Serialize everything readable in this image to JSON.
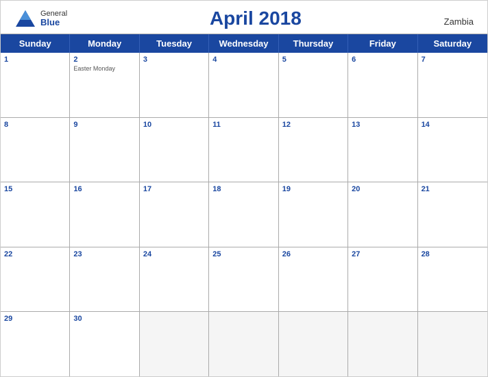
{
  "header": {
    "logo_general": "General",
    "logo_blue": "Blue",
    "title": "April 2018",
    "country": "Zambia"
  },
  "day_headers": [
    "Sunday",
    "Monday",
    "Tuesday",
    "Wednesday",
    "Thursday",
    "Friday",
    "Saturday"
  ],
  "weeks": [
    [
      {
        "day": "1",
        "holiday": "",
        "in_month": true
      },
      {
        "day": "2",
        "holiday": "Easter Monday",
        "in_month": true
      },
      {
        "day": "3",
        "holiday": "",
        "in_month": true
      },
      {
        "day": "4",
        "holiday": "",
        "in_month": true
      },
      {
        "day": "5",
        "holiday": "",
        "in_month": true
      },
      {
        "day": "6",
        "holiday": "",
        "in_month": true
      },
      {
        "day": "7",
        "holiday": "",
        "in_month": true
      }
    ],
    [
      {
        "day": "8",
        "holiday": "",
        "in_month": true
      },
      {
        "day": "9",
        "holiday": "",
        "in_month": true
      },
      {
        "day": "10",
        "holiday": "",
        "in_month": true
      },
      {
        "day": "11",
        "holiday": "",
        "in_month": true
      },
      {
        "day": "12",
        "holiday": "",
        "in_month": true
      },
      {
        "day": "13",
        "holiday": "",
        "in_month": true
      },
      {
        "day": "14",
        "holiday": "",
        "in_month": true
      }
    ],
    [
      {
        "day": "15",
        "holiday": "",
        "in_month": true
      },
      {
        "day": "16",
        "holiday": "",
        "in_month": true
      },
      {
        "day": "17",
        "holiday": "",
        "in_month": true
      },
      {
        "day": "18",
        "holiday": "",
        "in_month": true
      },
      {
        "day": "19",
        "holiday": "",
        "in_month": true
      },
      {
        "day": "20",
        "holiday": "",
        "in_month": true
      },
      {
        "day": "21",
        "holiday": "",
        "in_month": true
      }
    ],
    [
      {
        "day": "22",
        "holiday": "",
        "in_month": true
      },
      {
        "day": "23",
        "holiday": "",
        "in_month": true
      },
      {
        "day": "24",
        "holiday": "",
        "in_month": true
      },
      {
        "day": "25",
        "holiday": "",
        "in_month": true
      },
      {
        "day": "26",
        "holiday": "",
        "in_month": true
      },
      {
        "day": "27",
        "holiday": "",
        "in_month": true
      },
      {
        "day": "28",
        "holiday": "",
        "in_month": true
      }
    ],
    [
      {
        "day": "29",
        "holiday": "",
        "in_month": true
      },
      {
        "day": "30",
        "holiday": "",
        "in_month": true
      },
      {
        "day": "",
        "holiday": "",
        "in_month": false
      },
      {
        "day": "",
        "holiday": "",
        "in_month": false
      },
      {
        "day": "",
        "holiday": "",
        "in_month": false
      },
      {
        "day": "",
        "holiday": "",
        "in_month": false
      },
      {
        "day": "",
        "holiday": "",
        "in_month": false
      }
    ]
  ],
  "colors": {
    "blue": "#1a47a0",
    "white": "#ffffff",
    "border": "#aaaaaa"
  }
}
